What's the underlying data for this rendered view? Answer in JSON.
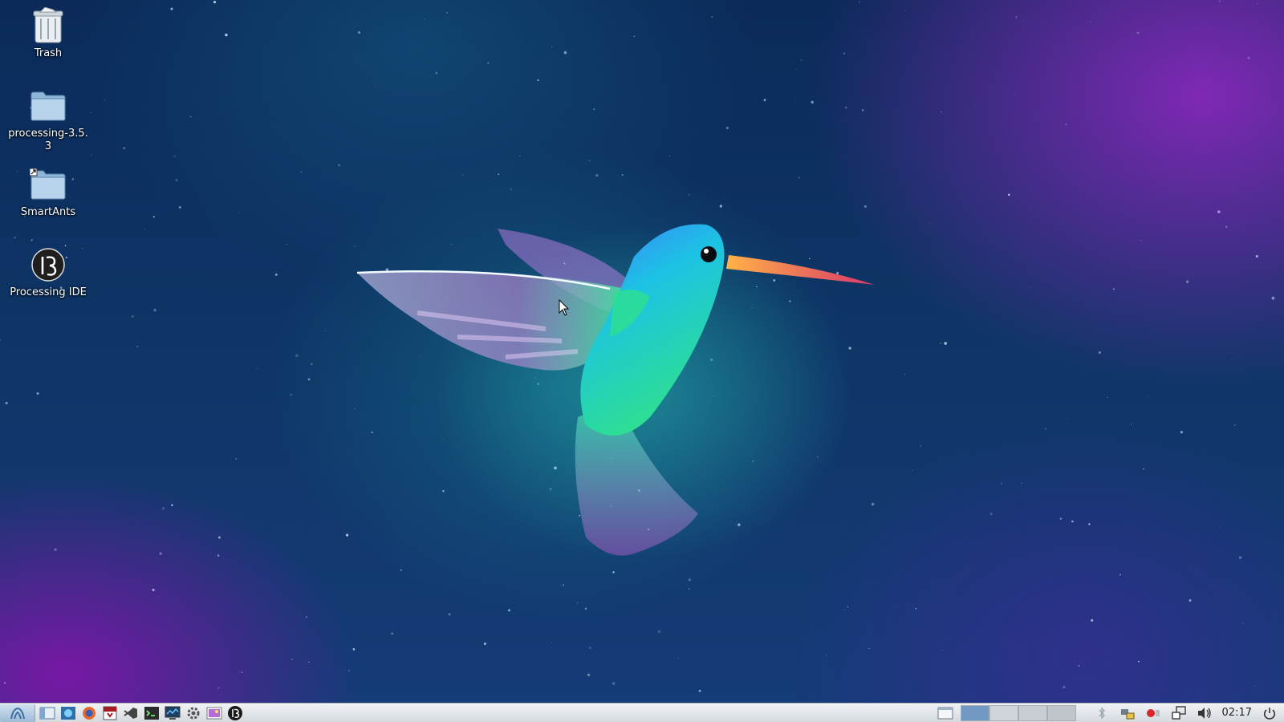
{
  "desktop": {
    "icons": [
      {
        "label": "Trash",
        "icon": "trash-icon"
      },
      {
        "label": "processing-3.5.3",
        "icon": "folder-icon"
      },
      {
        "label": "SmartAnts",
        "icon": "folder-link-icon"
      },
      {
        "label": "Processing IDE",
        "icon": "processing-icon"
      }
    ]
  },
  "taskbar": {
    "launchers": [
      "start-menu-icon",
      "file-manager-icon",
      "network-icon",
      "firefox-icon",
      "pdf-reader-icon",
      "visual-studio-code-icon",
      "terminal-icon",
      "system-monitor-icon",
      "settings-icon",
      "image-viewer-icon",
      "processing-icon"
    ],
    "tray": [
      "show-desktop-icon",
      "bluetooth-icon",
      "network-tray-icon",
      "record-icon",
      "display-icon",
      "volume-icon"
    ],
    "clock": "02:17"
  },
  "colors": {
    "taskbar_bg": "#dde2e7",
    "accent": "#4a90d9"
  }
}
